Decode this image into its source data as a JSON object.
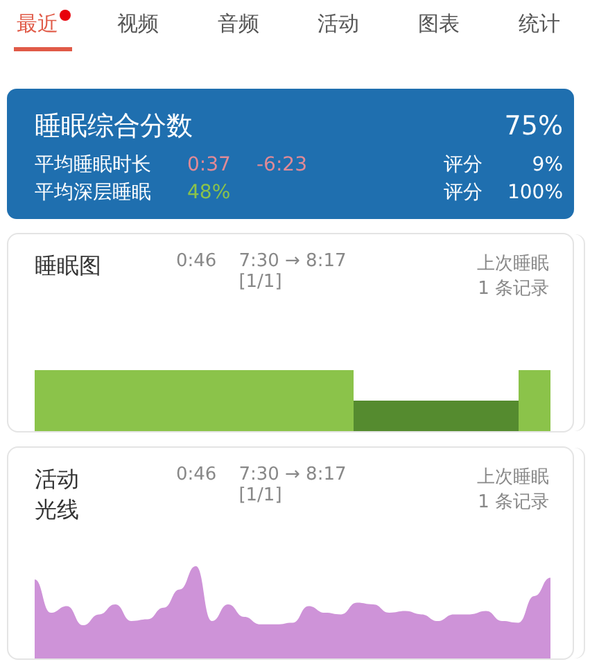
{
  "tabs": [
    {
      "label": "最近",
      "selected": true,
      "badge": true
    },
    {
      "label": "视频",
      "selected": false,
      "badge": false
    },
    {
      "label": "音频",
      "selected": false,
      "badge": false
    },
    {
      "label": "活动",
      "selected": false,
      "badge": false
    },
    {
      "label": "图表",
      "selected": false,
      "badge": false
    },
    {
      "label": "统计",
      "selected": false,
      "badge": false
    }
  ],
  "summary": {
    "title": "睡眠综合分数",
    "score": "75%",
    "rows": [
      {
        "label": "平均睡眠时长",
        "value": "0:37",
        "color": "#e08a96",
        "delta": "-6:23",
        "rating_label": "评分",
        "rating": "9%"
      },
      {
        "label": "平均深层睡眠",
        "value": "48%",
        "color": "#8bc34a",
        "rating_label": "评分",
        "rating": "100%"
      }
    ]
  },
  "cards": [
    {
      "kind": "hypnogram",
      "title_lines": [
        "睡眠图"
      ],
      "duration": "0:46",
      "range": "7:30 → 8:17",
      "page": "[1/1]",
      "caption": "上次睡眠",
      "count": "1 条记录"
    },
    {
      "kind": "activity",
      "title_lines": [
        "活动",
        "光线"
      ],
      "duration": "0:46",
      "range": "7:30 → 8:17",
      "page": "[1/1]",
      "caption": "上次睡眠",
      "count": "1 条记录"
    }
  ]
}
